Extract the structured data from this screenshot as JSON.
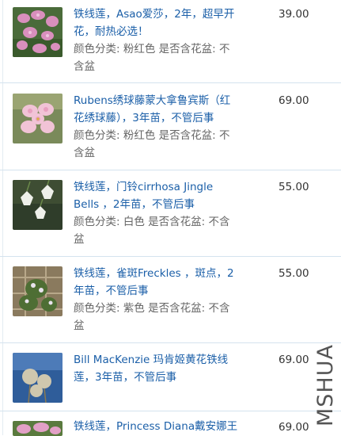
{
  "items": [
    {
      "title_line1": "铁线莲，Asao爱莎，2年，超早开",
      "title_line2": "花，耐热必选！",
      "spec_line1": "颜色分类: 粉红色 是否含花盆: 不",
      "spec_line2": "含盆",
      "price": "39.00",
      "image_icon": "pink-clematis-photo-icon"
    },
    {
      "title_line1": "Rubens绣球藤蒙大拿鲁宾斯（红",
      "title_line2": "花绣球藤），3年苗，不管后事",
      "spec_line1": "颜色分类: 粉红色 是否含花盆: 不",
      "spec_line2": "含盆",
      "price": "69.00",
      "image_icon": "pink-blossom-photo-icon"
    },
    {
      "title_line1": "铁线莲，门铃cirrhosa Jingle",
      "title_line2": "Bells ，2年苗，不管后事",
      "spec_line1": "颜色分类: 白色 是否含花盆: 不含",
      "spec_line2": "盆",
      "price": "55.00",
      "image_icon": "white-bell-flower-photo-icon"
    },
    {
      "title_line1": "铁线莲，雀斑Freckles ，斑点，2",
      "title_line2": "年苗，不管后事",
      "spec_line1": "颜色分类: 紫色 是否含花盆: 不含",
      "spec_line2": "盆",
      "price": "55.00",
      "image_icon": "trellis-vine-photo-icon"
    },
    {
      "title_line1": "Bill MacKenzie 玛肯姬黄花铁线",
      "title_line2": "莲，3年苗，不管后事",
      "price": "69.00",
      "image_icon": "fluffy-seedhead-photo-icon"
    },
    {
      "title_line1": "铁线莲，Princess Diana戴安娜王",
      "price": "69.00",
      "image_icon": "pink-flower-photo-icon"
    }
  ],
  "watermark": "MSHUA",
  "colors": {
    "link": "#1b5fa8",
    "spec": "#666666",
    "price": "#333333",
    "divider": "#d4e3ee"
  }
}
